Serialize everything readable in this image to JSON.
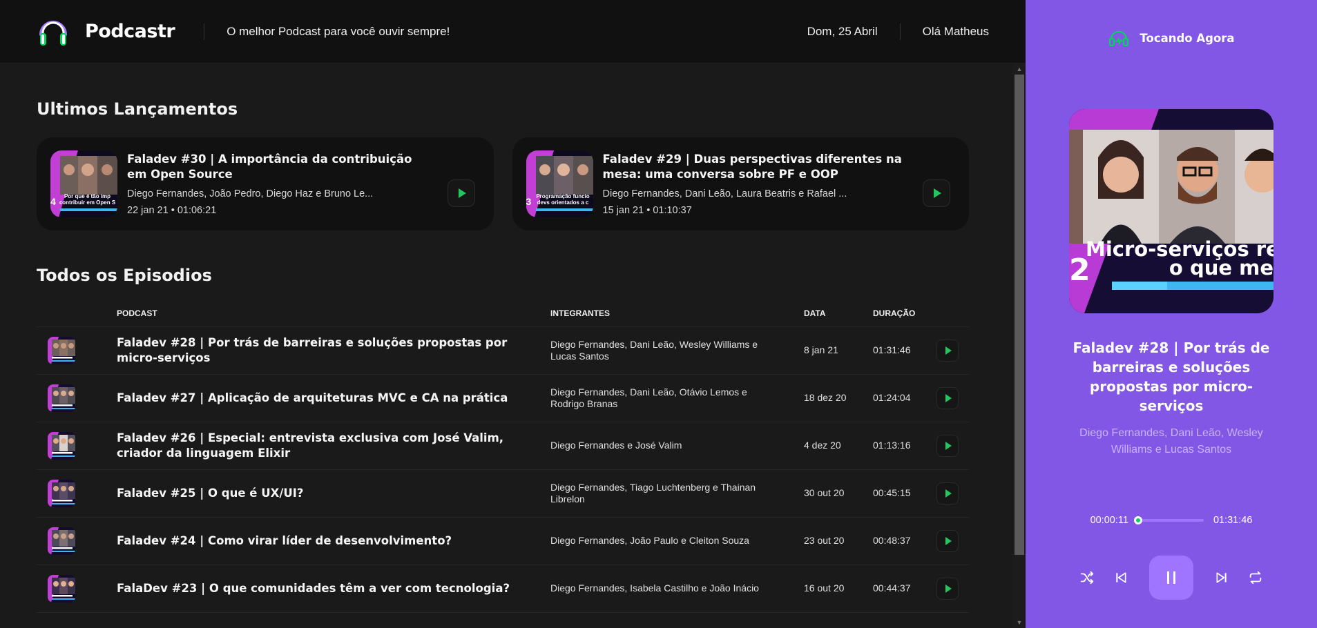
{
  "header": {
    "app_name": "Podcastr",
    "tagline": "O melhor Podcast para você ouvir sempre!",
    "date": "Dom, 25 Abril",
    "greeting": "Olá Matheus"
  },
  "latest": {
    "title": "Ultimos Lançamentos",
    "episodes": [
      {
        "title": "Faladev #30 | A importância da contribuição em Open Source",
        "members": "Diego Fernandes, João Pedro, Diego Haz e Bruno Le...",
        "date": "22 jan 21",
        "duration": "01:06:21",
        "thumb_text": "Por que é tão imp contribuir em Open S",
        "thumb_num": "4"
      },
      {
        "title": "Faladev #29 | Duas perspectivas diferentes na mesa: uma conversa sobre PF e OOP",
        "members": "Diego Fernandes, Dani Leão, Laura Beatris e Rafael ...",
        "date": "15 jan 21",
        "duration": "01:10:37",
        "thumb_text": "Programação funcio devs orientados a c",
        "thumb_num": "3"
      }
    ]
  },
  "all": {
    "title": "Todos os Episodios",
    "columns": [
      "PODCAST",
      "INTEGRANTES",
      "DATA",
      "DURAÇÃO"
    ],
    "rows": [
      {
        "title": "Faladev #28 | Por trás de barreiras e soluções propostas por micro-serviços",
        "members": "Diego Fernandes, Dani Leão, Wesley Williams e Lucas Santos",
        "date": "8 jan 21",
        "duration": "01:31:46"
      },
      {
        "title": "Faladev #27 | Aplicação de arquiteturas MVC e CA na prática",
        "members": "Diego Fernandes, Dani Leão, Otávio Lemos e Rodrigo Branas",
        "date": "18 dez 20",
        "duration": "01:24:04"
      },
      {
        "title": "Faladev #26 | Especial: entrevista exclusiva com José Valim, criador da linguagem Elixir",
        "members": "Diego Fernandes e José Valim",
        "date": "4 dez 20",
        "duration": "01:13:16"
      },
      {
        "title": "Faladev #25 | O que é UX/UI?",
        "members": "Diego Fernandes, Tiago Luchtenberg e Thainan Librelon",
        "date": "30 out 20",
        "duration": "00:45:15"
      },
      {
        "title": "Faladev #24 | Como virar líder de desenvolvimento?",
        "members": "Diego Fernandes, João Paulo e Cleiton Souza",
        "date": "23 out 20",
        "duration": "00:48:37"
      },
      {
        "title": "FalaDev #23 | O que comunidades têm a ver com tecnologia?",
        "members": "Diego Fernandes, Isabela Castilho e João Inácio",
        "date": "16 out 20",
        "duration": "00:44:37"
      }
    ]
  },
  "player": {
    "label": "Tocando Agora",
    "title": "Faladev #28 | Por trás de barreiras e soluções propostas por micro-serviços",
    "members": "Diego Fernandes, Dani Leão, Wesley Williams e Lucas Santos",
    "cover_text_line1": "Micro-serviços re",
    "cover_text_line2": "o que me",
    "cover_num": "2",
    "current_time": "00:00:11",
    "total_time": "01:31:46",
    "progress_fraction": 0.002
  },
  "colors": {
    "accent": "#8257e5",
    "accent_light": "#9f75ff",
    "green": "#04d361",
    "play_green": "#22c55e",
    "background": "#1a1a1a",
    "card": "#111111"
  },
  "icons": [
    "headphones-logo-icon",
    "headphones-icon",
    "play-icon",
    "shuffle-icon",
    "previous-icon",
    "pause-icon",
    "next-icon",
    "repeat-icon"
  ]
}
